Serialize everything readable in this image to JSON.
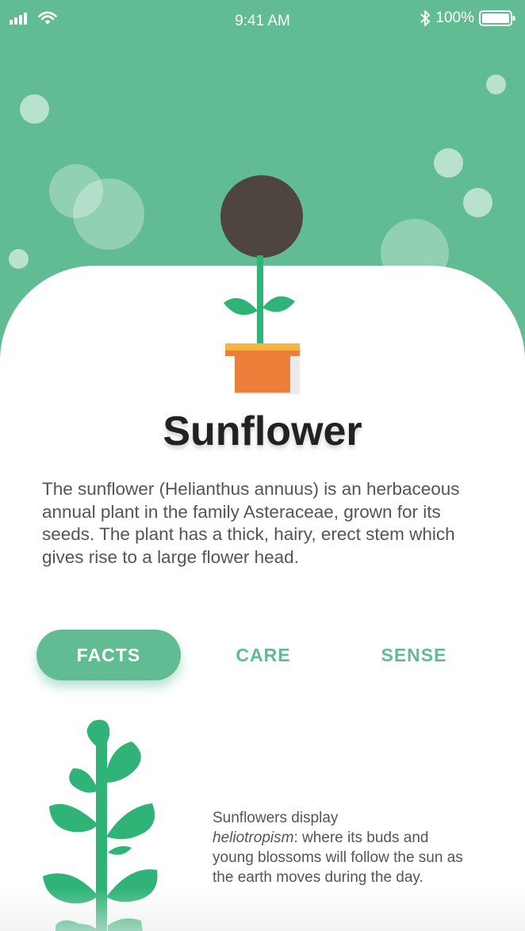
{
  "status_bar": {
    "time": "9:41 AM",
    "battery_label": "100%",
    "icons": [
      "signal-icon",
      "wifi-icon",
      "bluetooth-icon",
      "battery-icon"
    ]
  },
  "plant": {
    "name": "Sunflower",
    "description": "The sunflower (Helianthus annuus) is an herbaceous annual plant in the family Asteraceae, grown for its seeds. The plant has a thick, hairy, erect stem which gives rise to a large flower head."
  },
  "tabs": [
    {
      "label": "FACTS",
      "active": true
    },
    {
      "label": "CARE",
      "active": false
    },
    {
      "label": "SENSE",
      "active": false
    }
  ],
  "fact": {
    "intro": "Sunflowers display",
    "term": "heliotropism",
    "rest": ": where its buds and young blossoms will follow the sun as the earth moves during the day."
  },
  "colors": {
    "accent": "#62bc93",
    "petal": "#f6b53c",
    "flower_center": "#4e4440",
    "pot": "#ec7f3a",
    "leaf": "#2fb377"
  }
}
